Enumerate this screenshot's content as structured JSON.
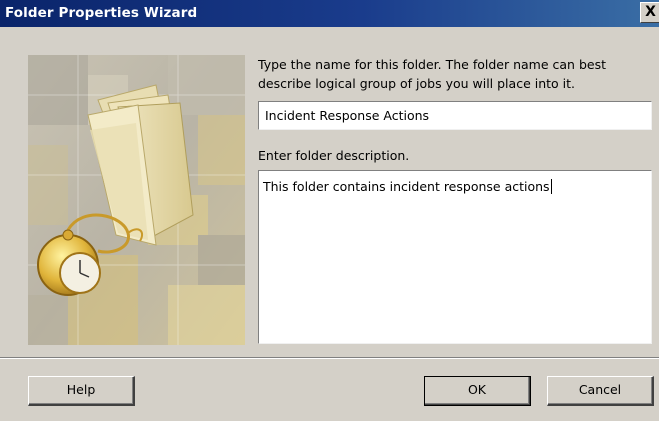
{
  "window": {
    "title": "Folder Properties Wizard",
    "close_glyph": "X"
  },
  "form": {
    "name_prompt": "Type the name for this folder. The folder name can best describe logical group of jobs you will place into it.",
    "name_value": "Incident Response Actions",
    "description_prompt": "Enter folder description.",
    "description_value": "This folder contains incident response actions"
  },
  "buttons": {
    "help_label": "Help",
    "ok_label": "OK",
    "cancel_label": "Cancel"
  },
  "image": {
    "icon_names": [
      "folder-icon",
      "pocket-watch-icon"
    ]
  },
  "colors": {
    "titlebar_start": "#0a246a",
    "titlebar_end": "#3a6ea5",
    "dialog_bg": "#d4d0c8"
  }
}
